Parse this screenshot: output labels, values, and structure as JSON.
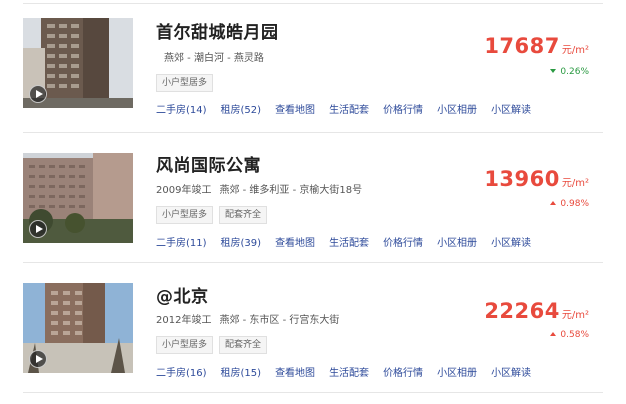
{
  "listings": [
    {
      "title": "首尔甜城皓月园",
      "year": "",
      "location": "燕郊 - 潮白河 - 燕灵路",
      "tags": [
        "小户型居多"
      ],
      "price": "17687",
      "unit": "元/m²",
      "change": "0.26%",
      "change_dir": "down",
      "links": [
        "二手房(14)",
        "租房(52)",
        "查看地图",
        "生活配套",
        "价格行情",
        "小区相册",
        "小区解读"
      ]
    },
    {
      "title": "风尚国际公寓",
      "year": "2009年竣工",
      "location": "燕郊 - 维多利亚 - 京榆大街18号",
      "tags": [
        "小户型居多",
        "配套齐全"
      ],
      "price": "13960",
      "unit": "元/m²",
      "change": "0.98%",
      "change_dir": "up",
      "links": [
        "二手房(11)",
        "租房(39)",
        "查看地图",
        "生活配套",
        "价格行情",
        "小区相册",
        "小区解读"
      ]
    },
    {
      "title": "@北京",
      "year": "2012年竣工",
      "location": "燕郊 - 东市区 - 行宫东大街",
      "tags": [
        "小户型居多",
        "配套齐全"
      ],
      "price": "22264",
      "unit": "元/m²",
      "change": "0.58%",
      "change_dir": "up",
      "links": [
        "二手房(16)",
        "租房(15)",
        "查看地图",
        "生活配套",
        "价格行情",
        "小区相册",
        "小区解读"
      ]
    }
  ]
}
